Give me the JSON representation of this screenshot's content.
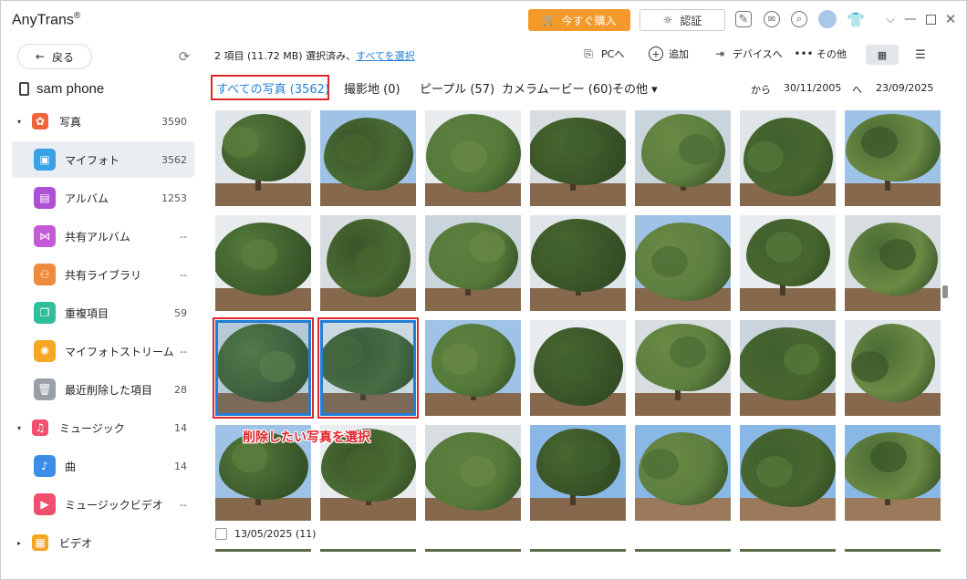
{
  "app": {
    "title": "AnyTrans",
    "reg": "®",
    "buy_label": "今すぐ購入",
    "auth_label": "認証"
  },
  "sidebar": {
    "back_label": "戻る",
    "device_name": "sam phone",
    "items": [
      {
        "label": "写真",
        "count": "3590",
        "section": true,
        "icon": "photos-icon",
        "color": "#f0643c"
      },
      {
        "label": "マイフォト",
        "count": "3562",
        "active": true,
        "icon": "my-photos-icon",
        "color": "#3aa0e8"
      },
      {
        "label": "アルバム",
        "count": "1253",
        "icon": "album-icon",
        "color": "#b04fd6"
      },
      {
        "label": "共有アルバム",
        "count": "--",
        "icon": "shared-album-icon",
        "color": "#c45ad6"
      },
      {
        "label": "共有ライブラリ",
        "count": "--",
        "icon": "shared-library-icon",
        "color": "#f08a3c"
      },
      {
        "label": "重複項目",
        "count": "59",
        "icon": "duplicate-icon",
        "color": "#2fbf9a"
      },
      {
        "label": "マイフォトストリーム",
        "count": "--",
        "icon": "photo-stream-icon",
        "color": "#f5a623"
      },
      {
        "label": "最近削除した項目",
        "count": "28",
        "icon": "trash-icon",
        "color": "#9aa0a8"
      },
      {
        "label": "ミュージック",
        "count": "14",
        "section": true,
        "icon": "music-icon",
        "color": "#f0506e"
      },
      {
        "label": "曲",
        "count": "14",
        "icon": "song-icon",
        "color": "#3a8ee8"
      },
      {
        "label": "ミュージックビデオ",
        "count": "--",
        "icon": "music-video-icon",
        "color": "#f0506e"
      },
      {
        "label": "ビデオ",
        "count": "",
        "section": true,
        "collapsed": true,
        "icon": "video-icon",
        "color": "#f5a623"
      }
    ]
  },
  "toolbar": {
    "selection_text": "2 項目 (11.72 MB) 選択済み、",
    "select_all_link": "すべてを選択",
    "to_pc": "PCへ",
    "add": "追加",
    "to_device": "デバイスへ",
    "more": "その他"
  },
  "tabs": [
    {
      "label": "すべての写真 (3562)",
      "active": true
    },
    {
      "label": "撮影地 (0)"
    },
    {
      "label": "ピープル (57)"
    },
    {
      "label": "カメラムービー (60)"
    },
    {
      "label": "その他 ▾"
    }
  ],
  "date_filter": {
    "from_label": "から",
    "from_date": "30/11/2005",
    "to_label": "へ",
    "to_date": "23/09/2025"
  },
  "annotation": "削除したい写真を選択",
  "date_group": "13/05/2025 (11)",
  "selected_photos": [
    14,
    15
  ]
}
